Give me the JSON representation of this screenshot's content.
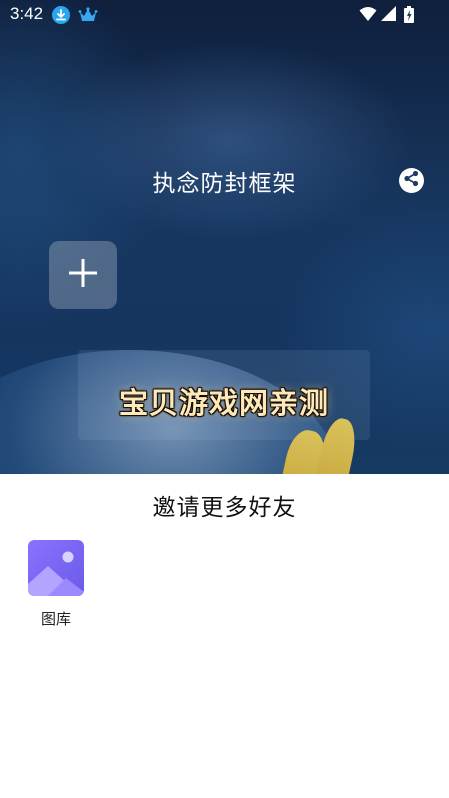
{
  "status_bar": {
    "time": "3:42",
    "icons": [
      "download-icon",
      "crown-icon",
      "wifi-icon",
      "signal-icon",
      "battery-icon"
    ]
  },
  "header": {
    "title": "执念防封框架",
    "share_icon": "share-icon"
  },
  "hero": {
    "add_icon": "plus-icon",
    "watermark": "宝贝游戏网亲测"
  },
  "share_sheet": {
    "title": "邀请更多好友",
    "options": [
      {
        "label": "图库",
        "icon": "gallery-icon"
      }
    ]
  },
  "colors": {
    "hero_background": "#173760",
    "sheet_background": "#ffffff",
    "gallery_icon": "#7a66f0"
  }
}
